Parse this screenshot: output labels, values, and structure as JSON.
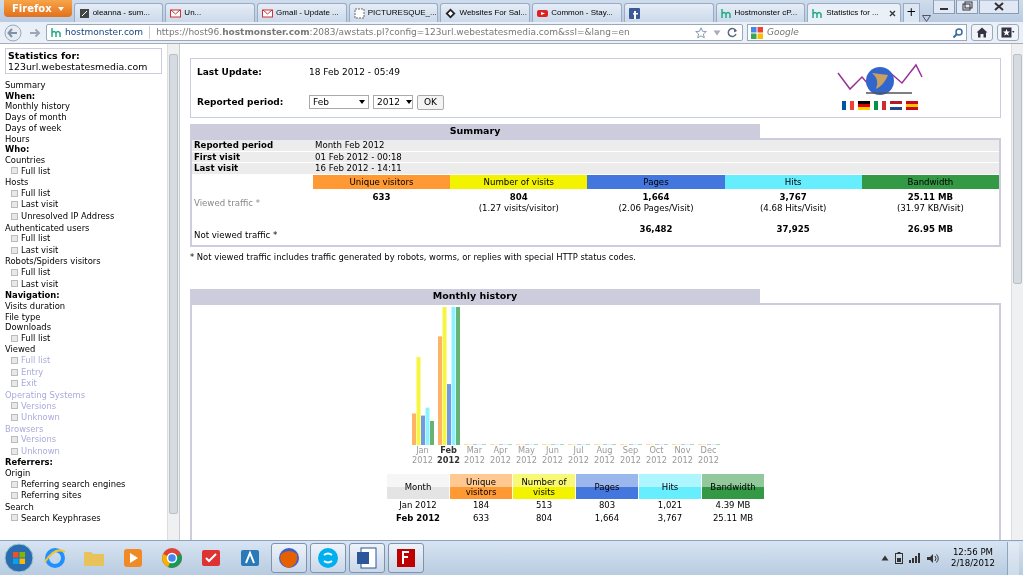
{
  "browser": {
    "menu_button": "Firefox",
    "tabs": [
      {
        "title": "oleanna - sum...",
        "selected": false
      },
      {
        "title": "Un...",
        "selected": false
      },
      {
        "title": "Gmail - Update ...",
        "selected": false
      },
      {
        "title": "PICTURESQUE_...",
        "selected": false
      },
      {
        "title": "Websites For Sal...",
        "selected": false
      },
      {
        "title": "Common - Stay...",
        "selected": false
      },
      {
        "selected": false
      },
      {
        "title": "Hostmonster cP...",
        "selected": false
      },
      {
        "title": "Statistics for ...",
        "selected": true
      }
    ],
    "new_tab": "+",
    "site_identity": "hostmonster.com",
    "url": "https://host96.**hostmonster.com**:2083/awstats.pl?config=123url.webestatesmedia.com&ssl=&lang=en",
    "search": {
      "placeholder": "Google"
    }
  },
  "sidebar": {
    "title": "Statistics for:",
    "site": "123url.webestatesmedia.com",
    "items": [
      {
        "kind": "link",
        "label": "Summary",
        "disabled": false
      },
      {
        "kind": "heading",
        "label": "When:"
      },
      {
        "kind": "link",
        "label": "Monthly history",
        "disabled": false
      },
      {
        "kind": "link",
        "label": "Days of month",
        "disabled": false
      },
      {
        "kind": "link",
        "label": "Days of week",
        "disabled": false
      },
      {
        "kind": "link",
        "label": "Hours",
        "disabled": false
      },
      {
        "kind": "heading",
        "label": "Who:"
      },
      {
        "kind": "link",
        "label": "Countries",
        "disabled": false,
        "children": [
          {
            "label": "Full list",
            "disabled": false
          }
        ]
      },
      {
        "kind": "link",
        "label": "Hosts",
        "disabled": false,
        "children": [
          {
            "label": "Full list",
            "disabled": false
          },
          {
            "label": "Last visit",
            "disabled": false
          },
          {
            "label": "Unresolved IP Address",
            "disabled": false
          }
        ]
      },
      {
        "kind": "link",
        "label": "Authenticated users",
        "disabled": false,
        "children": [
          {
            "label": "Full list",
            "disabled": false
          },
          {
            "label": "Last visit",
            "disabled": false
          }
        ]
      },
      {
        "kind": "link",
        "label": "Robots/Spiders visitors",
        "disabled": false,
        "children": [
          {
            "label": "Full list",
            "disabled": false
          },
          {
            "label": "Last visit",
            "disabled": false
          }
        ]
      },
      {
        "kind": "heading",
        "label": "Navigation:"
      },
      {
        "kind": "link",
        "label": "Visits duration",
        "disabled": false
      },
      {
        "kind": "link",
        "label": "File type",
        "disabled": false
      },
      {
        "kind": "link",
        "label": "Downloads",
        "disabled": false,
        "children": [
          {
            "label": "Full list",
            "disabled": false
          }
        ]
      },
      {
        "kind": "link",
        "label": "Viewed",
        "disabled": false,
        "children": [
          {
            "label": "Full list",
            "disabled": true
          },
          {
            "label": "Entry",
            "disabled": true
          },
          {
            "label": "Exit",
            "disabled": true
          }
        ]
      },
      {
        "kind": "link",
        "label": "Operating Systems",
        "disabled": true,
        "children": [
          {
            "label": "Versions",
            "disabled": true
          },
          {
            "label": "Unknown",
            "disabled": true
          }
        ]
      },
      {
        "kind": "link",
        "label": "Browsers",
        "disabled": true,
        "children": [
          {
            "label": "Versions",
            "disabled": true
          },
          {
            "label": "Unknown",
            "disabled": true
          }
        ]
      },
      {
        "kind": "heading",
        "label": "Referrers:"
      },
      {
        "kind": "link",
        "label": "Origin",
        "disabled": false,
        "children": [
          {
            "label": "Referring search engines",
            "disabled": false
          },
          {
            "label": "Referring sites",
            "disabled": false
          }
        ]
      },
      {
        "kind": "link",
        "label": "Search",
        "disabled": false,
        "children": [
          {
            "label": "Search Keyphrases",
            "disabled": false
          }
        ]
      }
    ]
  },
  "header": {
    "last_update_label": "Last Update:",
    "last_update": "18 Feb 2012 - 05:49",
    "period_label": "Reported period:",
    "month": "Feb",
    "year": "2012",
    "ok_button": "OK"
  },
  "summary": {
    "title": "Summary",
    "info": [
      [
        "Reported period",
        "Month Feb 2012"
      ],
      [
        "First visit",
        "01 Feb 2012 - 00:18"
      ],
      [
        "Last visit",
        "16 Feb 2012 - 14:11"
      ]
    ],
    "columns": [
      {
        "label": "Unique visitors",
        "color": "#ff9933"
      },
      {
        "label": "Number of visits",
        "color": "#f3f300"
      },
      {
        "label": "Pages",
        "color": "#4477dd"
      },
      {
        "label": "Hits",
        "color": "#66eeff"
      },
      {
        "label": "Bandwidth",
        "color": "#339944"
      }
    ],
    "rows": [
      {
        "label": "Viewed traffic *",
        "dim": true,
        "cells": [
          {
            "value": "633"
          },
          {
            "value": "804",
            "detail": "(1.27 visits/visitor)"
          },
          {
            "value": "1,664",
            "detail": "(2.06 Pages/Visit)"
          },
          {
            "value": "3,767",
            "detail": "(4.68 Hits/Visit)"
          },
          {
            "value": "25.11 MB",
            "detail": "(31.97 KB/Visit)"
          }
        ]
      },
      {
        "label": "Not viewed traffic *",
        "dim": false,
        "cells": [
          null,
          null,
          {
            "value": "36,482"
          },
          {
            "value": "37,925"
          },
          {
            "value": "26.95 MB"
          }
        ]
      }
    ],
    "note": "* Not viewed traffic includes traffic generated by robots, worms, or replies with special HTTP status codes."
  },
  "monthly": {
    "title": "Monthly history",
    "axis": [
      {
        "month": "Jan",
        "year": "2012",
        "selected": false
      },
      {
        "month": "Feb",
        "year": "2012",
        "selected": true
      },
      {
        "month": "Mar",
        "year": "2012",
        "selected": false
      },
      {
        "month": "Apr",
        "year": "2012",
        "selected": false
      },
      {
        "month": "May",
        "year": "2012",
        "selected": false
      },
      {
        "month": "Jun",
        "year": "2012",
        "selected": false
      },
      {
        "month": "Jul",
        "year": "2012",
        "selected": false
      },
      {
        "month": "Aug",
        "year": "2012",
        "selected": false
      },
      {
        "month": "Sep",
        "year": "2012",
        "selected": false
      },
      {
        "month": "Oct",
        "year": "2012",
        "selected": false
      },
      {
        "month": "Nov",
        "year": "2012",
        "selected": false
      },
      {
        "month": "Dec",
        "year": "2012",
        "selected": false
      }
    ],
    "columns": [
      "Month",
      "Unique visitors",
      "Number of visits",
      "Pages",
      "Hits",
      "Bandwidth"
    ],
    "rows": [
      {
        "selected": false,
        "cells": [
          "Jan 2012",
          "184",
          "513",
          "803",
          "1,021",
          "4.39 MB"
        ]
      },
      {
        "selected": true,
        "cells": [
          "Feb 2012",
          "633",
          "804",
          "1,664",
          "3,767",
          "25.11 MB"
        ]
      }
    ]
  },
  "taskbar": {
    "apps": [
      {
        "running": false
      },
      {
        "running": false
      },
      {
        "running": false
      },
      {
        "running": false
      },
      {
        "running": false
      },
      {
        "running": false
      },
      {
        "running": true
      },
      {
        "running": true
      },
      {
        "running": true
      },
      {
        "running": true
      }
    ],
    "time": "12:56 PM",
    "date": "2/18/2012"
  }
}
